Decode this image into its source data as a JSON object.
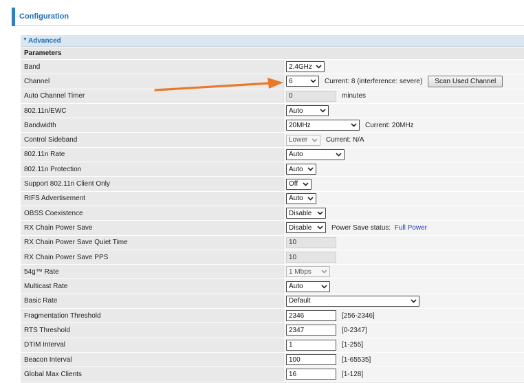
{
  "header": {
    "title": "Configuration"
  },
  "section": {
    "title": "Advanced"
  },
  "params": {
    "title": "Parameters"
  },
  "rows": {
    "band": {
      "label": "Band",
      "value": "2.4GHz"
    },
    "channel": {
      "label": "Channel",
      "value": "6",
      "note": "Current: 8 (interference: severe)",
      "button": "Scan Used Channel"
    },
    "auto_timer": {
      "label": "Auto Channel Timer",
      "value": "0",
      "unit": "minutes"
    },
    "ewc": {
      "label": "802.11n/EWC",
      "value": "Auto"
    },
    "bandwidth": {
      "label": "Bandwidth",
      "value": "20MHz",
      "note": "Current: 20MHz"
    },
    "sideband": {
      "label": "Control Sideband",
      "value": "Lower",
      "note": "Current: N/A"
    },
    "n_rate": {
      "label": "802.11n Rate",
      "value": "Auto"
    },
    "n_protection": {
      "label": "802.11n Protection",
      "value": "Auto"
    },
    "n_only": {
      "label": "Support 802.11n Client Only",
      "value": "Off"
    },
    "rifs": {
      "label": "RIFS Advertisement",
      "value": "Auto"
    },
    "obss": {
      "label": "OBSS Coexistence",
      "value": "Disable"
    },
    "rx_save": {
      "label": "RX Chain Power Save",
      "value": "Disable",
      "note_prefix": "Power Save status:",
      "note_value": "Full Power"
    },
    "rx_quiet": {
      "label": "RX Chain Power Save Quiet Time",
      "value": "10"
    },
    "rx_pps": {
      "label": "RX Chain Power Save PPS",
      "value": "10"
    },
    "g_rate": {
      "label": "54g™ Rate",
      "value": "1 Mbps"
    },
    "mcast": {
      "label": "Multicast Rate",
      "value": "Auto"
    },
    "basic_rate": {
      "label": "Basic Rate",
      "value": "Default"
    },
    "frag": {
      "label": "Fragmentation Threshold",
      "value": "2346",
      "range": "[256-2346]"
    },
    "rts": {
      "label": "RTS Threshold",
      "value": "2347",
      "range": "[0-2347]"
    },
    "dtim": {
      "label": "DTIM Interval",
      "value": "1",
      "range": "[1-255]"
    },
    "beacon": {
      "label": "Beacon Interval",
      "value": "100",
      "range": "[1-65535]"
    },
    "global_max": {
      "label": "Global Max Clients",
      "value": "16",
      "range": "[1-128]"
    }
  },
  "colors": {
    "accent": "#2d7fc4",
    "arrow": "#e8792a",
    "link": "#1f40b5"
  },
  "icons": {
    "dropdown": "chevron-down-icon",
    "section_toggle": "caret-down-icon",
    "annotation": "arrow-icon"
  }
}
